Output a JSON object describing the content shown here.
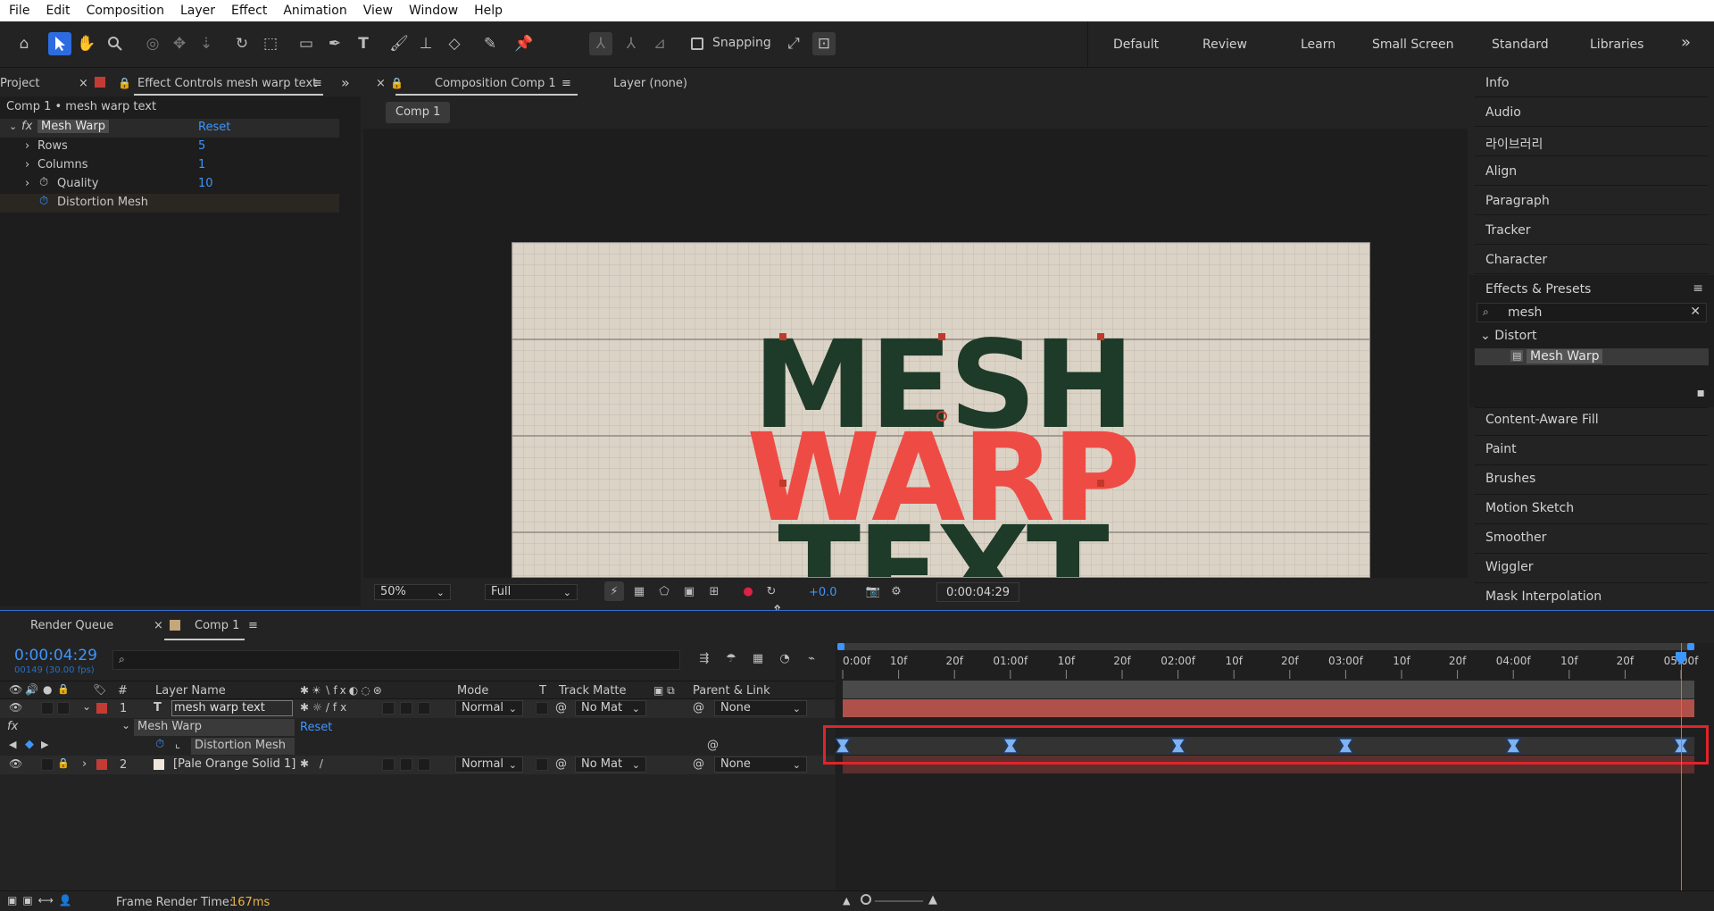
{
  "menubar": {
    "items": [
      "File",
      "Edit",
      "Composition",
      "Layer",
      "Effect",
      "Animation",
      "View",
      "Window",
      "Help"
    ]
  },
  "toolbar": {
    "tools": [
      "home-icon",
      "selection-tool-icon",
      "hand-tool-icon",
      "zoom-tool-icon",
      "orbit-camera-icon",
      "pan-camera-icon",
      "dolly-camera-icon",
      "rotate-tool-icon",
      "pan-behind-icon",
      "rectangle-tool-icon",
      "pen-tool-icon",
      "type-tool-icon",
      "brush-tool-icon",
      "clone-stamp-icon",
      "eraser-icon",
      "roto-brush-icon",
      "puppet-pin-icon"
    ],
    "snapping_label": "Snapping",
    "workspaces": [
      "Default",
      "Review",
      "Learn",
      "Small Screen",
      "Standard",
      "Libraries"
    ],
    "more": "»"
  },
  "effect_controls": {
    "project_tab": "Project",
    "tab_title": "Effect Controls mesh warp text",
    "header": "Comp 1 • mesh warp text",
    "effect_name": "Mesh Warp",
    "reset_label": "Reset",
    "properties": [
      {
        "label": "Rows",
        "value": "5"
      },
      {
        "label": "Columns",
        "value": "1"
      },
      {
        "label": "Quality",
        "value": "10"
      }
    ],
    "distortion_mesh": "Distortion Mesh"
  },
  "composition": {
    "tab_title": "Composition Comp 1",
    "layer_tab": "Layer (none)",
    "comp_button": "Comp 1",
    "canvas_text": [
      "MESH",
      "WARP",
      "TEXT"
    ],
    "zoom": "50%",
    "resolution": "Full",
    "exposure": "+0.0",
    "timecode": "0:00:04:29",
    "colors": {
      "dark_green": "#1e3a28",
      "red": "#ef4b45",
      "paper": "#dcd3c7"
    }
  },
  "right_panel": {
    "items_top": [
      "Info",
      "Audio",
      "라이브러리",
      "Align",
      "Paragraph",
      "Tracker",
      "Character"
    ],
    "effects_presets_title": "Effects & Presets",
    "search_value": "mesh",
    "category": "Distort",
    "result": "Mesh Warp",
    "items_bottom": [
      "Content-Aware Fill",
      "Paint",
      "Brushes",
      "Motion Sketch",
      "Smoother",
      "Wiggler",
      "Mask Interpolation"
    ]
  },
  "timeline": {
    "render_queue_tab": "Render Queue",
    "comp_tab": "Comp 1",
    "timecode": "0:00:04:29",
    "frame_info": "00149 (30.00 fps)",
    "columns": {
      "layer_name": "Layer Name",
      "num": "#",
      "mode": "Mode",
      "t": "T",
      "track_matte": "Track Matte",
      "parent": "Parent & Link"
    },
    "layers": [
      {
        "num": "1",
        "name": "mesh warp text",
        "mode": "Normal",
        "matte": "No Mat",
        "parent": "None"
      },
      {
        "num": "2",
        "name": "[Pale Orange Solid 1]",
        "mode": "Normal",
        "matte": "No Mat",
        "parent": "None"
      }
    ],
    "effect_row": {
      "name": "Mesh Warp",
      "reset": "Reset"
    },
    "property_row": {
      "name": "Distortion Mesh"
    },
    "ruler_labels": [
      "0:00f",
      "10f",
      "20f",
      "01:00f",
      "10f",
      "20f",
      "02:00f",
      "10f",
      "20f",
      "03:00f",
      "10f",
      "20f",
      "04:00f",
      "10f",
      "20f",
      "05:00f"
    ],
    "keyframe_count": 6,
    "footer": {
      "render_label": "Frame Render Time:",
      "render_value": "167ms"
    }
  }
}
